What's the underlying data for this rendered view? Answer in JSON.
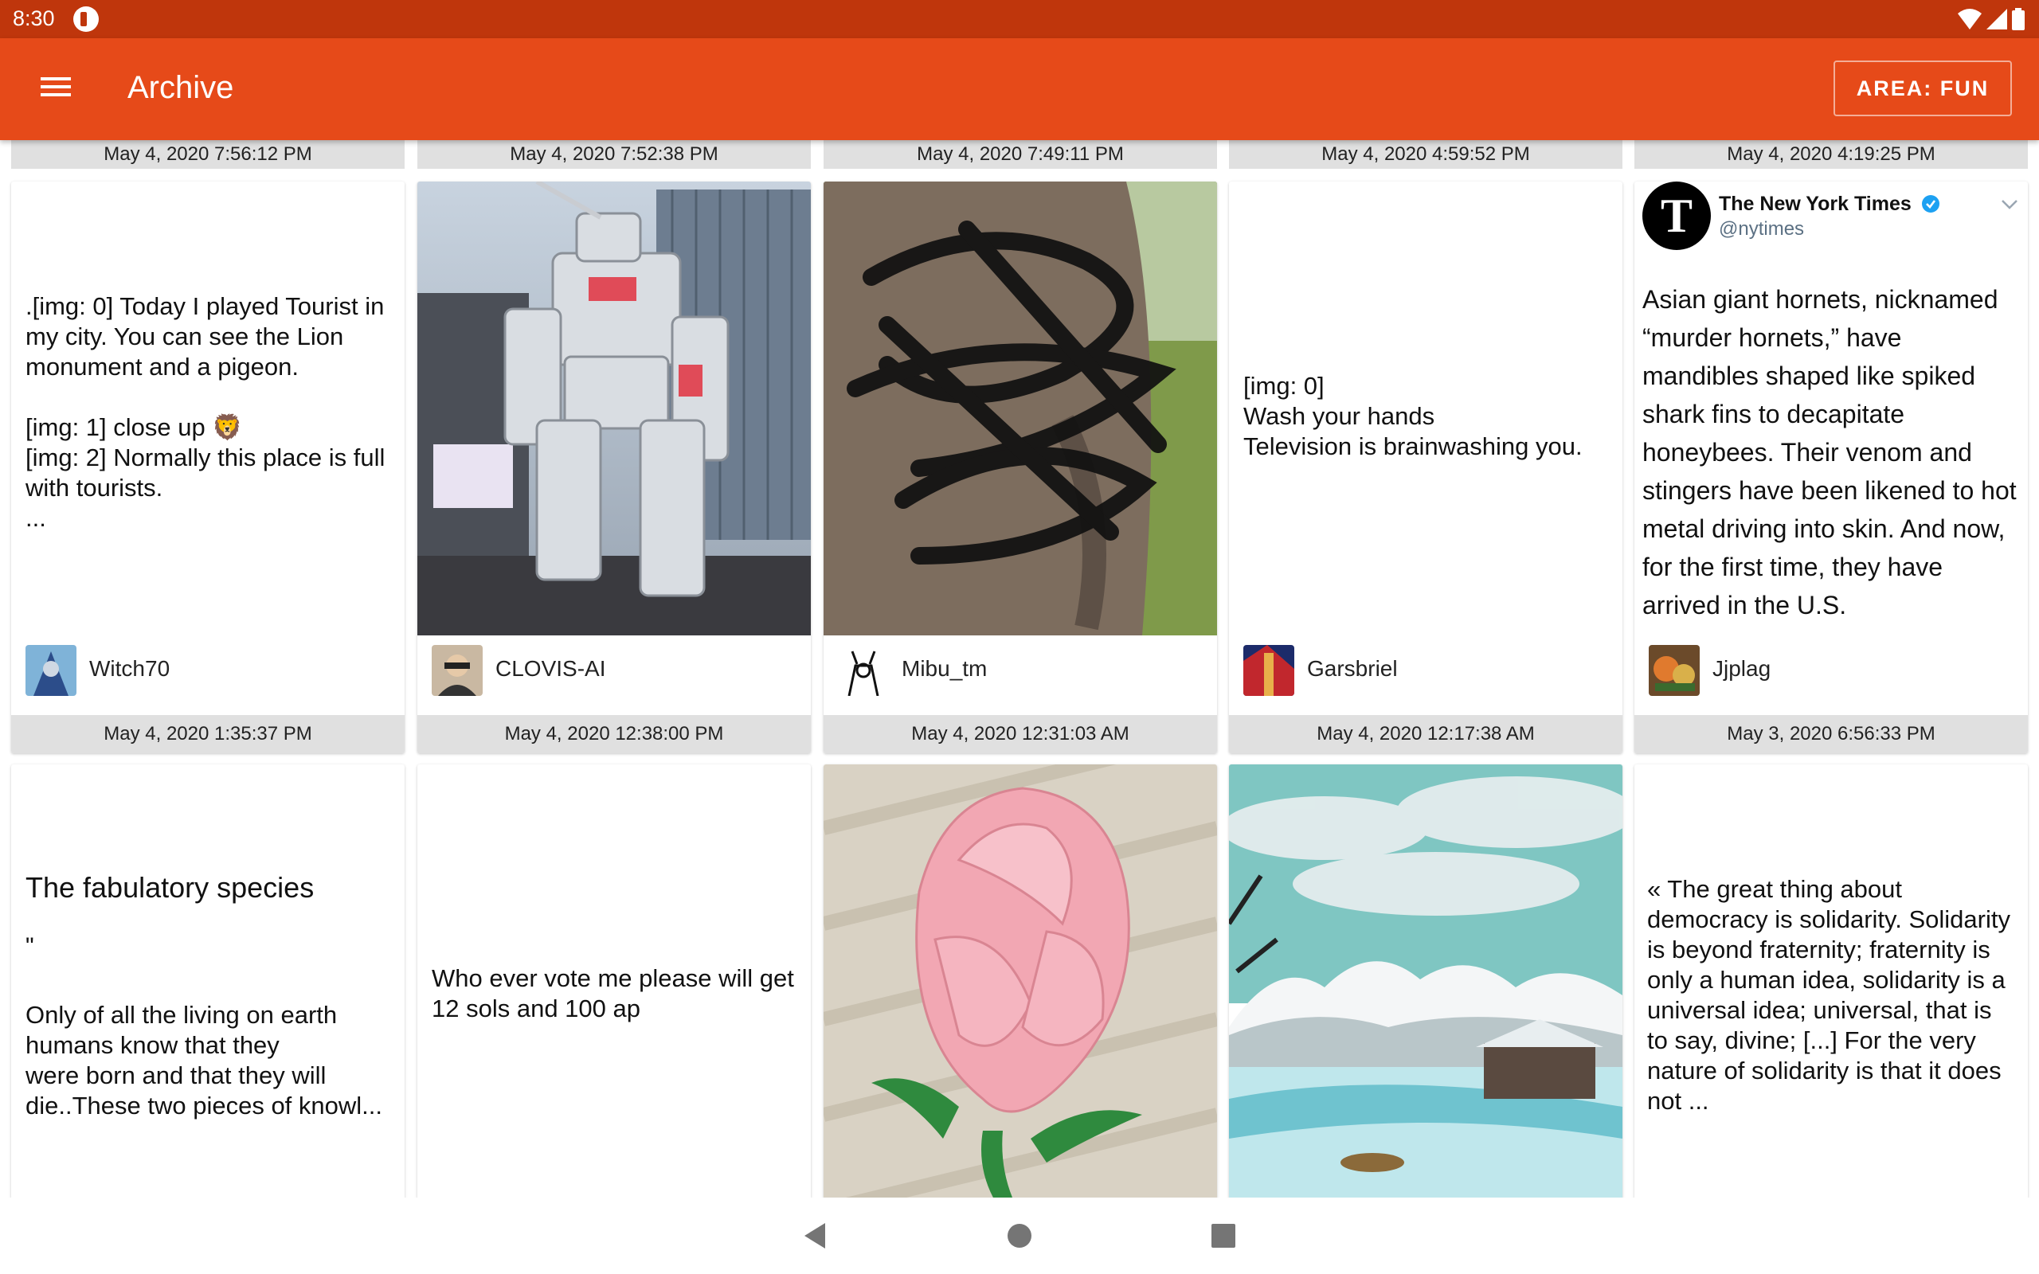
{
  "status": {
    "time": "8:30"
  },
  "appbar": {
    "title": "Archive",
    "area_label": "AREA: FUN"
  },
  "top_dates": [
    "May 4, 2020 7:56:12 PM",
    "May 4, 2020 7:52:38 PM",
    "May 4, 2020 7:49:11 PM",
    "May 4, 2020 4:59:52 PM",
    "May 4, 2020 4:19:25 PM"
  ],
  "row1": [
    {
      "text": ".[img: 0] Today I played Tourist in my city. You can see the Lion monument and a pigeon.\n\n[img: 1] close up 🦁\n[img: 2] Normally this place is full with tourists.\n...",
      "user": "Witch70",
      "date": "May 4, 2020 1:35:37 PM"
    },
    {
      "text": "",
      "user": "CLOVIS-AI",
      "date": "May 4, 2020 12:38:00 PM"
    },
    {
      "text": "",
      "user": "Mibu_tm",
      "date": "May 4, 2020 12:31:03 AM"
    },
    {
      "text": "[img: 0]\nWash your hands\nTelevision is brainwashing you.",
      "user": "Garsbriel",
      "date": "May 4, 2020 12:17:38 AM"
    },
    {
      "text": "Asian giant hornets, nicknamed “murder hornets,” have mandibles shaped like spiked shark fins to decapitate honeybees. Their venom and stingers have been likened to hot metal driving into skin. And now, for the first time, they have arrived in the U.S.",
      "user": "Jjplag",
      "date": "May 3, 2020 6:56:33 PM"
    }
  ],
  "tweet": {
    "name": "The New York Times",
    "handle": "@nytimes"
  },
  "row2": [
    {
      "title": "The fabulatory species",
      "quote": "\"",
      "text": "Only of all the living on earth humans know that they\nwere born and that they will die..These two pieces of knowl..."
    },
    {
      "text": "Who ever vote me please will get 12 sols and 100 ap"
    },
    {
      "text": ""
    },
    {
      "text": ""
    },
    {
      "text": "« The great thing about democracy is solidarity. Solidarity is beyond fraternity; fraternity is only a human idea, solidarity is a universal idea; universal, that is to say, divine; [...] For the very nature of solidarity is that it does not ..."
    }
  ]
}
